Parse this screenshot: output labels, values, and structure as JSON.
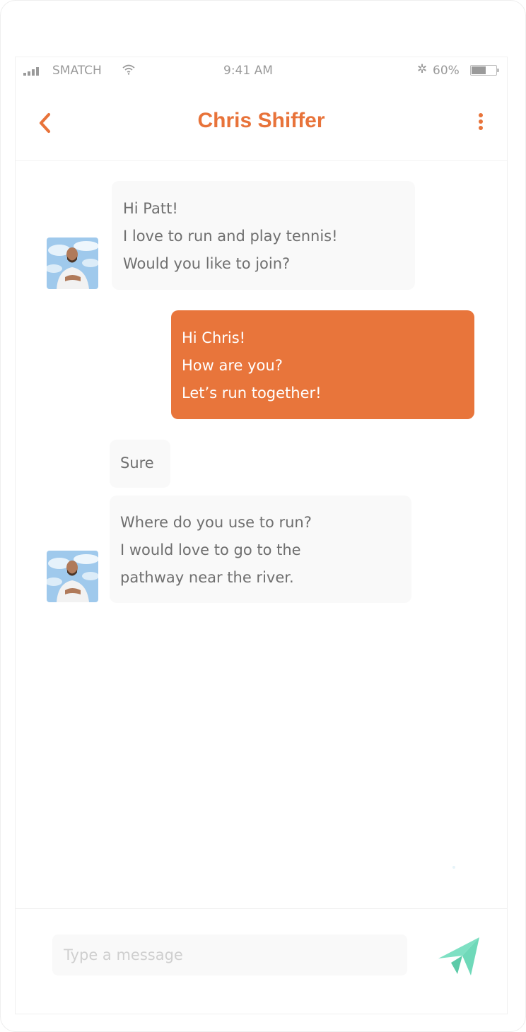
{
  "status_bar": {
    "carrier": "SMATCH",
    "time": "9:41 AM",
    "battery_percent": "60%",
    "battery_level": 0.6,
    "icons": [
      "signal-icon",
      "wifi-icon",
      "bluetooth-icon",
      "battery-icon"
    ]
  },
  "header": {
    "title": "Chris Shiffer",
    "back_icon": "chevron-left-icon",
    "menu_icon": "more-vertical-icon"
  },
  "messages": [
    {
      "from": "contact",
      "lines": [
        "Hi Patt!",
        "I love to run and play tennis!",
        "Would you like to join?"
      ]
    },
    {
      "from": "me",
      "lines": [
        "Hi Chris!",
        "How are you?",
        "Let’s run together!"
      ]
    },
    {
      "from": "contact",
      "lines": [
        "Sure"
      ]
    },
    {
      "from": "contact",
      "lines": [
        "Where do you use to run?",
        "I would love to go to the",
        "pathway near the river."
      ]
    }
  ],
  "composer": {
    "placeholder": "Type a message",
    "send_icon": "paper-plane-icon"
  },
  "colors": {
    "accent": "#e8733a",
    "outgoing_bubble": "#e8753b",
    "incoming_bubble": "#f9f9f9",
    "send_button": "#7ee0c3",
    "text_muted": "#6f6f6f"
  }
}
